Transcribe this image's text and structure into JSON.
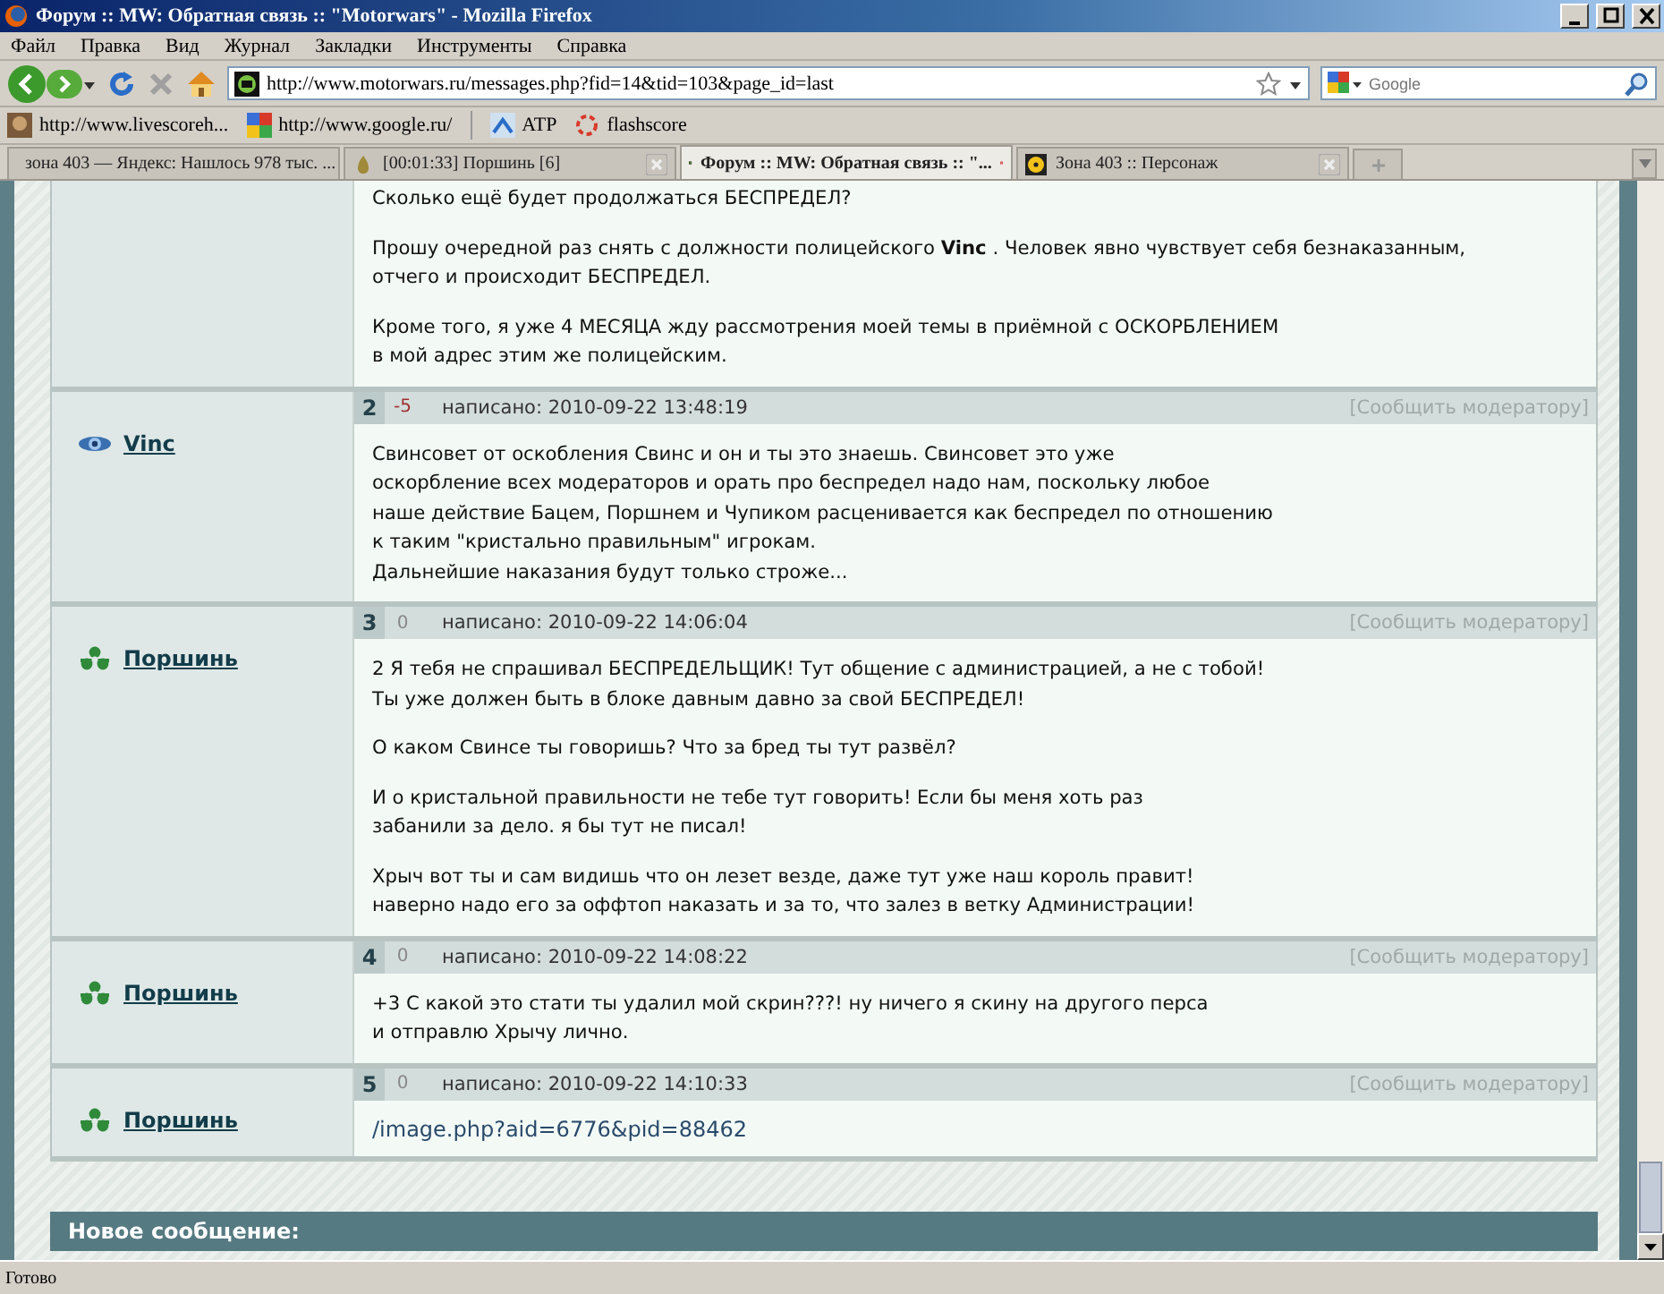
{
  "window": {
    "title": "Форум :: MW: Обратная связь :: \"Motorwars\" - Mozilla Firefox"
  },
  "menu": [
    "Файл",
    "Правка",
    "Вид",
    "Журнал",
    "Закладки",
    "Инструменты",
    "Справка"
  ],
  "address": {
    "value": "http://www.motorwars.ru/messages.php?fid=14&tid=103&page_id=last"
  },
  "search": {
    "placeholder": "Google"
  },
  "bookmarks": [
    "http://www.livescoreh...",
    "http://www.google.ru/",
    "ATP",
    "flashscore"
  ],
  "tabs": [
    {
      "label": "зона 403 — Яндекс: Нашлось 978 тыс. ...",
      "selected": false
    },
    {
      "label": "[00:01:33] Поршинь [6]",
      "selected": false
    },
    {
      "label": "Форум :: MW: Обратная связь :: \"...",
      "selected": true
    },
    {
      "label": "Зона 403 :: Персонаж",
      "selected": false
    }
  ],
  "posts": [
    {
      "kind": "continued",
      "paragraphs": [
        "Сколько ещё будет продолжаться БЕСПРЕДЕЛ?",
        "Прошу очередной раз снять с должности полицейского **Vinc** . Человек явно чувствует себя безнаказанным,\nотчего и происходит БЕСПРЕДЕЛ.",
        "Кроме того, я уже 4 МЕСЯЦА жду рассмотрения моей темы в приёмной с ОСКОРБЛЕНИЕМ\nв мой адрес этим же полицейским."
      ]
    },
    {
      "kind": "full",
      "author": {
        "name": "Vinc",
        "kind": "eye"
      },
      "number": "2",
      "rating": "-5",
      "rating_negative": true,
      "date": "написано: 2010-09-22 13:48:19",
      "report": "[Сообщить модератору]",
      "paragraphs": [
        "Свинсовет от оскобления Свинс и он и ты это знаешь. Свинсовет это уже\nоскорбление всех модераторов и орать про беспредел надо нам, поскольку любое\nнаше действие Бацем, Поршнем и Чупиком расценивается как беспредел по отношению\nк таким \"кристально правильным\" игрокам.\nДальнейшие наказания будут только строже..."
      ]
    },
    {
      "kind": "full",
      "author": {
        "name": "Поршинь",
        "kind": "hazard"
      },
      "number": "3",
      "rating": "0",
      "rating_negative": false,
      "date": "написано: 2010-09-22 14:06:04",
      "report": "[Сообщить модератору]",
      "paragraphs": [
        "2 Я тебя не спрашивал БЕСПРЕДЕЛЬЩИК! Тут общение с администрацией, а не с тобой!\nТы уже должен быть в блоке давным давно за свой БЕСПРЕДЕЛ!",
        "О каком Свинсе ты говоришь? Что за бред ты тут развёл?",
        "И о кристальной правильности не тебе тут говорить! Если бы меня хоть раз\nзабанили за дело. я бы тут не писал!",
        "Хрыч вот ты и сам видишь что он лезет везде, даже тут уже наш король правит!\nнаверно надо его за оффтоп наказать и за то, что залез в ветку Администрации!"
      ]
    },
    {
      "kind": "full",
      "author": {
        "name": "Поршинь",
        "kind": "hazard"
      },
      "number": "4",
      "rating": "0",
      "rating_negative": false,
      "date": "написано: 2010-09-22 14:08:22",
      "report": "[Сообщить модератору]",
      "paragraphs": [
        "+3 С какой это стати ты удалил мой скрин???! ну ничего я скину на другого перса\nи отправлю Хрычу лично."
      ]
    },
    {
      "kind": "full",
      "author": {
        "name": "Поршинь",
        "kind": "hazard"
      },
      "number": "5",
      "rating": "0",
      "rating_negative": false,
      "date": "написано: 2010-09-22 14:10:33",
      "report": "[Сообщить модератору]",
      "link": "/image.php?aid=6776&pid=88462"
    }
  ],
  "new_message": {
    "title": "Новое сообщение:"
  },
  "status_bar": {
    "text": "Готово"
  }
}
